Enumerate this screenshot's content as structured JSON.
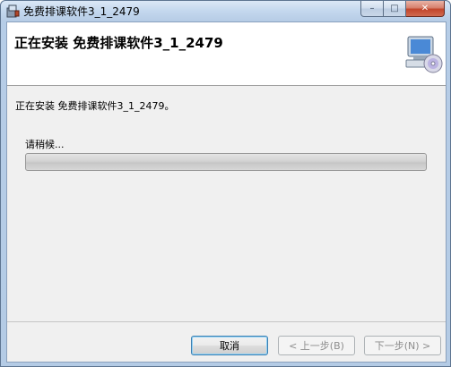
{
  "window": {
    "title": "免费排课软件3_1_2479",
    "controls": {
      "minimize": "–",
      "maximize": "□",
      "close": "✕"
    }
  },
  "header": {
    "title": "正在安装 免费排课软件3_1_2479"
  },
  "main": {
    "status_text": "正在安装 免费排课软件3_1_2479。",
    "wait_label": "请稍候...",
    "progress": 0
  },
  "footer": {
    "cancel_label": "取消",
    "back_label": "< 上一步(B)",
    "next_label": "下一步(N) >"
  },
  "icons": {
    "app": "installer-app-icon",
    "header": "computer-disc-icon"
  },
  "colors": {
    "accent": "#3c7fb1",
    "close": "#c2452b",
    "progress_fill": "#37c937"
  }
}
